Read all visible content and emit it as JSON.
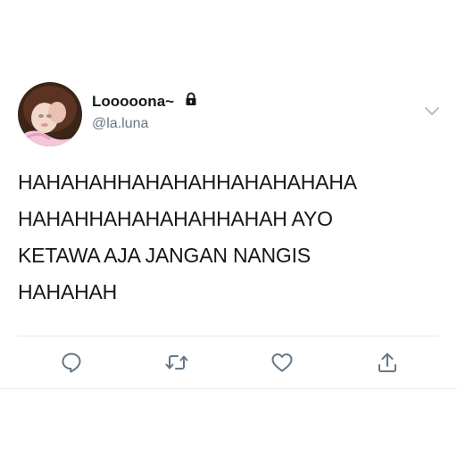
{
  "user": {
    "display_name": "Looooona~",
    "handle": "@la.luna",
    "protected": true
  },
  "tweet": {
    "lines": [
      "HAHAHAHHAHAHAHHAHAHAHAHA",
      "HAHAHHAHAHAHAHHAHAH AYO",
      "KETAWA AJA JANGAN NANGIS",
      "HAHAHAH"
    ]
  },
  "icons": {
    "lock": "lock-icon",
    "menu": "chevron-down-icon",
    "reply": "reply-icon",
    "retweet": "retweet-icon",
    "like": "heart-icon",
    "share": "share-icon"
  },
  "colors": {
    "text": "#14171a",
    "secondary": "#657786",
    "divider": "#e6ecf0",
    "icon": "#657786"
  }
}
